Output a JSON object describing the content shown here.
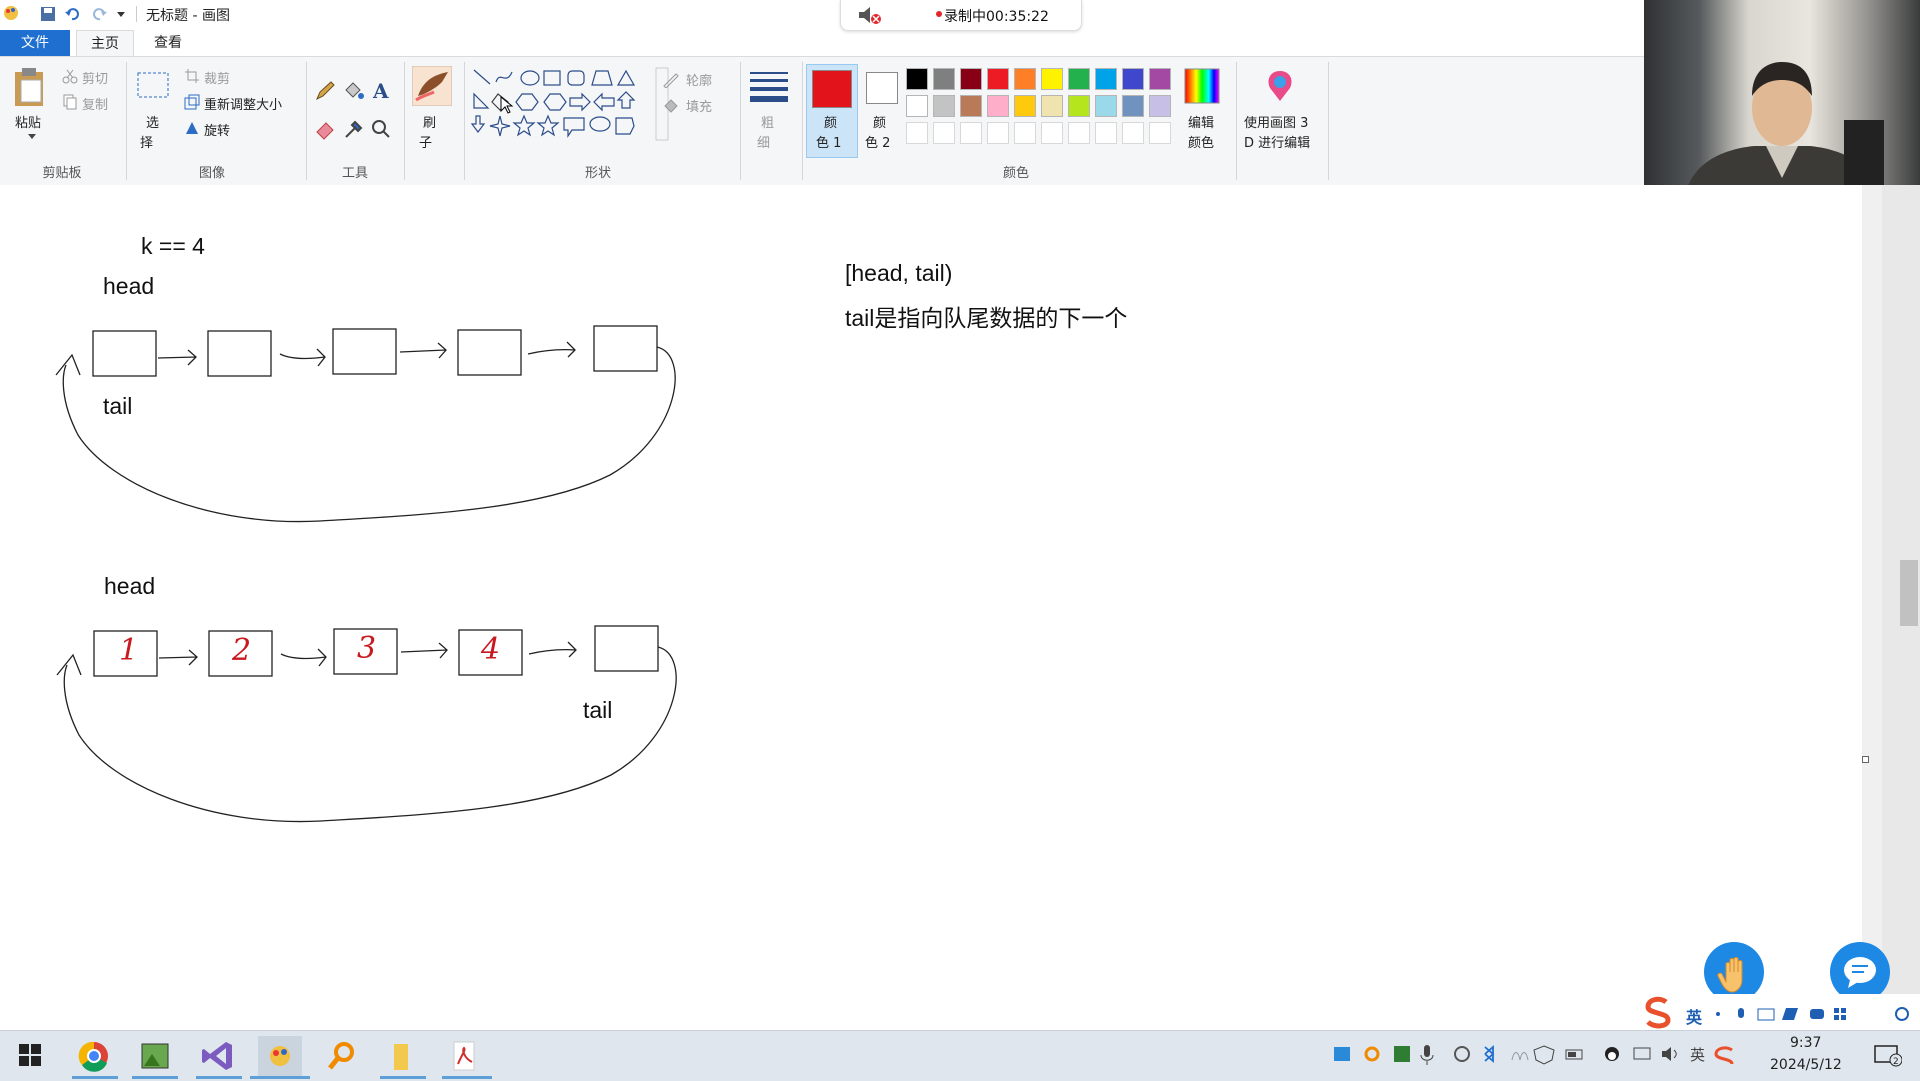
{
  "window": {
    "title": "无标题 - 画图"
  },
  "recording": {
    "label": "录制中00:35:22"
  },
  "tabs": {
    "file": "文件",
    "home": "主页",
    "view": "查看"
  },
  "ribbon": {
    "clipboard": {
      "paste": "粘贴",
      "cut": "剪切",
      "copy": "复制",
      "label": "剪贴板"
    },
    "image": {
      "select_top": "选",
      "select_bottom": "择",
      "crop": "裁剪",
      "resize": "重新调整大小",
      "rotate": "旋转",
      "label": "图像"
    },
    "tools": {
      "label": "工具"
    },
    "brush": {
      "top": "刷",
      "bottom": "子"
    },
    "shapes": {
      "outline": "轮廓",
      "fill": "填充",
      "label": "形状"
    },
    "size": {
      "top": "粗",
      "bottom": "细"
    },
    "colors": {
      "color1_top": "颜",
      "color1_bottom": "色 1",
      "color2_top": "颜",
      "color2_bottom": "色 2",
      "edit_top": "编辑",
      "edit_bottom": "颜色",
      "label": "颜色",
      "color1_value": "#e3131b",
      "palette_row1": [
        "#000000",
        "#7f7f7f",
        "#880015",
        "#ed1c24",
        "#ff7f27",
        "#fff200",
        "#22b14c",
        "#00a2e8",
        "#3f48cc",
        "#a349a4"
      ],
      "palette_row2": [
        "#ffffff",
        "#c3c3c3",
        "#b97a57",
        "#ffaec9",
        "#ffc90e",
        "#efe4b0",
        "#b5e61d",
        "#99d9ea",
        "#7092be",
        "#c8bfe7"
      ]
    },
    "paint3d": {
      "top": "使用画图 3",
      "bottom": "D 进行编辑"
    }
  },
  "canvas": {
    "k_label": "k == 4",
    "head1": "head",
    "tail1": "tail",
    "head2": "head",
    "tail2": "tail",
    "node_values": [
      "1",
      "2",
      "3",
      "4"
    ],
    "range_label": "[head, tail)",
    "note": "tail是指向队尾数据的下一个"
  },
  "taskbar": {
    "time": "9:37",
    "date": "2024/5/12"
  },
  "ime": {
    "lang": "英"
  }
}
